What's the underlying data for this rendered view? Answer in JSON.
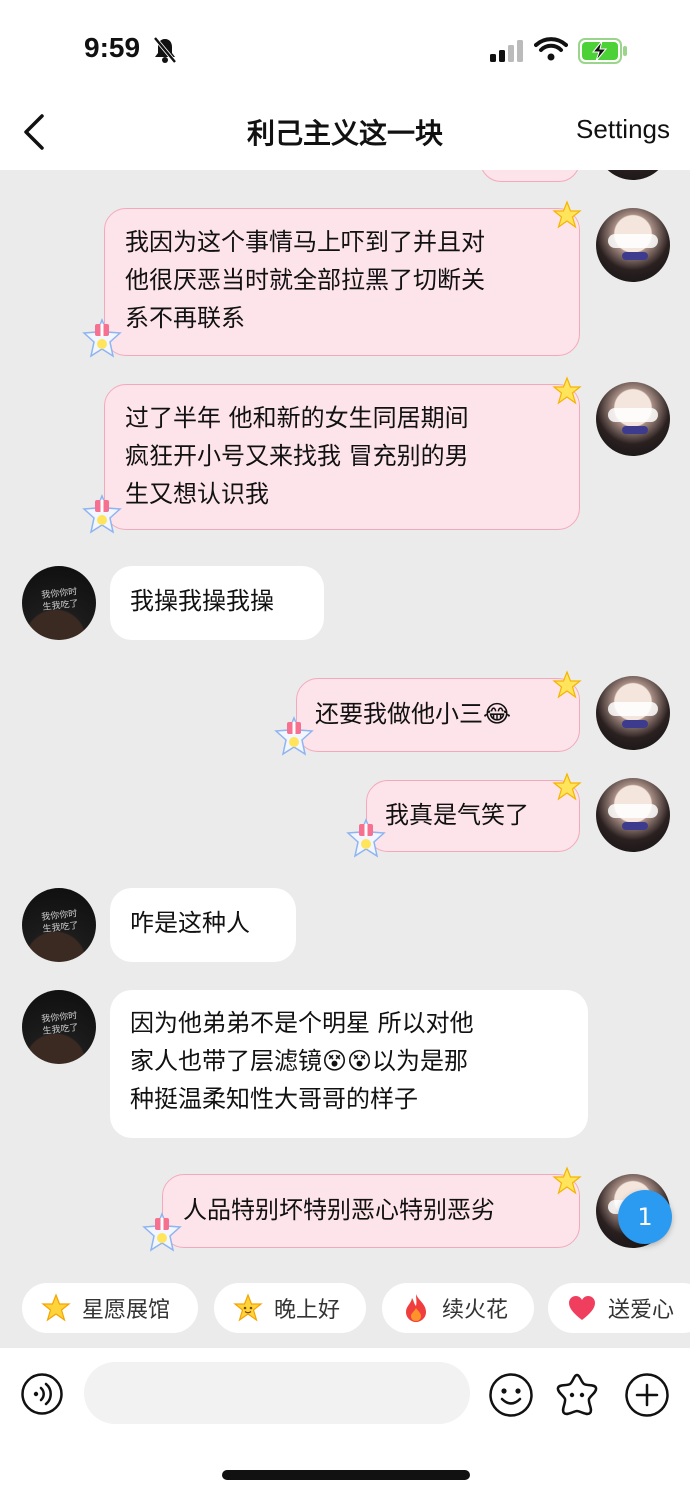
{
  "status": {
    "time": "9:59"
  },
  "nav": {
    "title": "利己主义这一块",
    "settings_label": "Settings"
  },
  "messages": [
    {
      "side": "right",
      "lines": [
        "我因为这个事情马上吓到了并且对",
        "他很厌恶当时就全部拉黑了切断关",
        "系不再联系"
      ]
    },
    {
      "side": "right",
      "lines": [
        "过了半年 他和新的女生同居期间",
        "疯狂开小号又来找我 冒充别的男",
        "生又想认识我"
      ]
    },
    {
      "side": "left",
      "lines": [
        "我操我操我操"
      ]
    },
    {
      "side": "right",
      "lines": [
        "还要我做他小三"
      ],
      "emoji": "😂"
    },
    {
      "side": "right",
      "lines": [
        "我真是气笑了"
      ]
    },
    {
      "side": "left",
      "lines": [
        "咋是这种人"
      ]
    },
    {
      "side": "left",
      "lines": [
        "因为他弟弟不是个明星 所以对他",
        "家人也带了层滤镜",
        "以为是那",
        "种挺温柔知性大哥哥的样子"
      ],
      "emoji": "😵😵"
    },
    {
      "side": "right",
      "lines": [
        "人品特别坏特别恶心特别恶劣"
      ]
    }
  ],
  "avatar_text": {
    "line1": "我你你时",
    "line2": "生我吃了"
  },
  "unread_count": "1",
  "quick_actions": [
    {
      "label": "星愿展馆",
      "icon": "star-icon"
    },
    {
      "label": "晚上好",
      "icon": "star-smile-icon"
    },
    {
      "label": "续火花",
      "icon": "fire-icon"
    },
    {
      "label": "送爱心",
      "icon": "heart-icon"
    }
  ],
  "input": {
    "placeholder": ""
  },
  "colors": {
    "bubble_mine": "#fde4ea",
    "bubble_mine_border": "#f3a9bc",
    "bubble_other": "#ffffff",
    "badge": "#2a9bf0"
  }
}
